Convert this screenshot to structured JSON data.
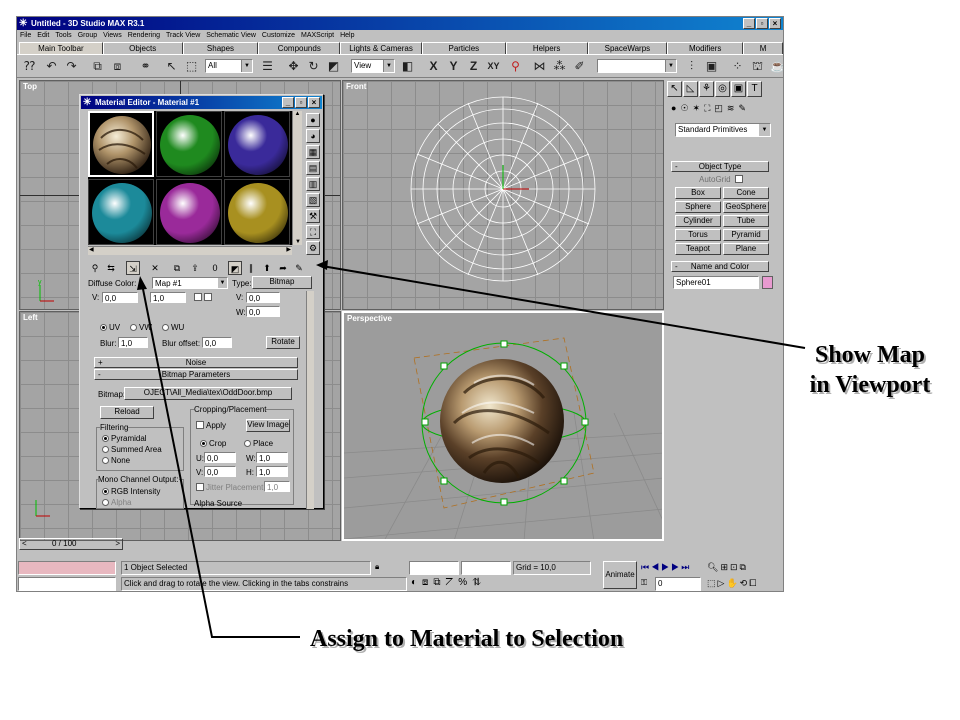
{
  "window": {
    "title": "Untitled - 3D Studio MAX R3.1",
    "min": "_",
    "max": "▫",
    "close": "×"
  },
  "menu": [
    "File",
    "Edit",
    "Tools",
    "Group",
    "Views",
    "Rendering",
    "Track View",
    "Schematic View",
    "Customize",
    "MAXScript",
    "Help"
  ],
  "tabs": [
    "Main Toolbar",
    "Objects",
    "Shapes",
    "Compounds",
    "Lights & Cameras",
    "Particles",
    "Helpers",
    "SpaceWarps",
    "Modifiers",
    "M"
  ],
  "toolbar": {
    "selection_filter": "All",
    "ref_coord": "View",
    "axis_x": "X",
    "axis_y": "Y",
    "axis_z": "Z",
    "axis_xy": "XY"
  },
  "viewports": {
    "top": "Top",
    "front": "Front",
    "left": "Left",
    "perspective": "Perspective"
  },
  "material_editor": {
    "title": "Material Editor - Material #1",
    "diffuse_label": "Diffuse Color:",
    "map_name": "Map #1",
    "type_label": "Type:",
    "type_value": "Bitmap",
    "coords": {
      "v_label": "V:",
      "w_label": "W:",
      "u_val": "0,0",
      "v_val": "1,0",
      "v_tiling": "0,0",
      "w_val": "0,0"
    },
    "uv": "UV",
    "vw": "VW",
    "wu": "WU",
    "blur_label": "Blur:",
    "blur_value": "1,0",
    "blur_offset_label": "Blur offset:",
    "blur_offset_value": "0,0",
    "rotate_button": "Rotate",
    "noise_rollout": "Noise",
    "bitmap_rollout": "Bitmap Parameters",
    "bitmap_label": "Bitmap:",
    "bitmap_path": "OJECT\\All_Media\\tex\\OddDoor.bmp",
    "reload_button": "Reload",
    "cropping_title": "Cropping/Placement",
    "apply_label": "Apply",
    "view_image_button": "View Image",
    "crop_label": "Crop",
    "place_label": "Place",
    "u_label": "U:",
    "w_label2": "W:",
    "v_label2": "V:",
    "h_label": "H:",
    "crop_u": "0,0",
    "crop_w": "1,0",
    "crop_v": "0,0",
    "crop_h": "1,0",
    "jitter_label": "Jitter Placement:",
    "jitter_value": "1,0",
    "filtering_title": "Filtering",
    "pyramidal": "Pyramidal",
    "summed_area": "Summed Area",
    "none": "None",
    "mono_title": "Mono Channel Output:",
    "rgb_intensity": "RGB Intensity",
    "alpha": "Alpha",
    "alpha_source": "Alpha Source",
    "sphere_colors": [
      "#c8b48c",
      "#1f8a1f",
      "#3a2a9a",
      "#1c8a9a",
      "#9a2a9a",
      "#a89020"
    ]
  },
  "command_panel": {
    "category": "Standard Primitives",
    "object_type": "Object Type",
    "autogrid": "AutoGrid",
    "buttons": [
      "Box",
      "Cone",
      "Sphere",
      "GeoSphere",
      "Cylinder",
      "Tube",
      "Torus",
      "Pyramid",
      "Teapot",
      "Plane"
    ],
    "name_color": "Name and Color",
    "object_name": "Sphere01",
    "object_color": "#e89ad0"
  },
  "timeline": {
    "frame": "0 / 100",
    "prev": "<",
    "next": ">"
  },
  "status": {
    "selected": "1 Object Selected",
    "prompt": "Click and drag to rotate the view.  Clicking in the tabs constrains",
    "grid": "Grid = 10,0",
    "animate": "Animate",
    "frame_value": "0"
  },
  "annotations": {
    "show_map": "Show Map in Viewport",
    "assign": "Assign to Material to Selection"
  }
}
